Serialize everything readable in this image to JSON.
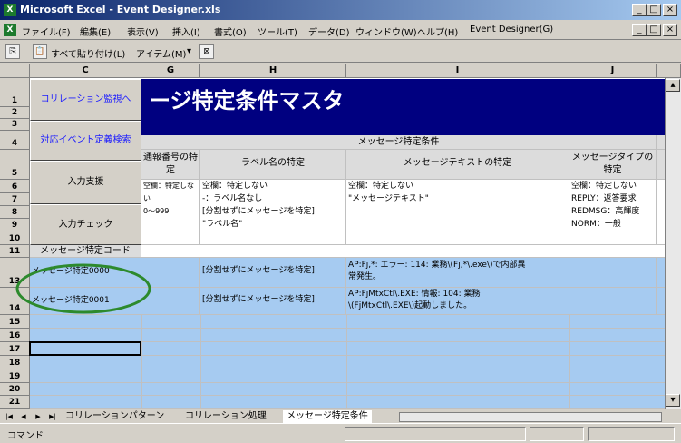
{
  "window": {
    "title": "Microsoft Excel - Event Designer.xls",
    "buttons": [
      "_",
      "□",
      "×"
    ]
  },
  "menu": [
    "ファイル(F)",
    "編集(E)",
    "表示(V)",
    "挿入(I)",
    "書式(O)",
    "ツール(T)",
    "データ(D)",
    "ウィンドウ(W)",
    "ヘルプ(H)",
    "Event Designer(G)"
  ],
  "doc_buttons": [
    "_",
    "□",
    "×"
  ],
  "toolbar": {
    "paste_all": "すべて貼り付け(L)",
    "items": "アイテム(M)"
  },
  "columns": [
    "C",
    "G",
    "H",
    "I",
    "J"
  ],
  "rows": [
    "1",
    "2",
    "3",
    "4",
    "5",
    "6",
    "7",
    "8",
    "9",
    "10",
    "11",
    "13",
    "14",
    "15",
    "16",
    "17",
    "18",
    "19",
    "20",
    "21"
  ],
  "nav_buttons": {
    "correlation_monitor": "コリレーション監視へ",
    "event_def_search": "対応イベント定義検索",
    "input_support": "入力支援",
    "input_check": "入力チェック"
  },
  "sheet": {
    "banner": "ージ特定条件マスタ",
    "section_title": "メッセージ特定条件",
    "code_header": "メッセージ特定コード",
    "headers": {
      "g": "通報番号の特定",
      "h": "ラベル名の特定",
      "i": "メッセージテキストの特定",
      "j": "メッセージタイプの特定"
    },
    "notes": {
      "g": [
        "空欄：特定しない",
        "0～999"
      ],
      "h": [
        "空欄：特定しない",
        "-：ラベル名なし",
        "[分割せずにメッセージを特定]",
        "\"ラベル名\""
      ],
      "i": [
        "空欄：特定しない",
        "\"メッセージテキスト\""
      ],
      "j": [
        "空欄：特定しない",
        "REPLY：返答要求",
        "REDMSG：高輝度",
        "NORM：一般"
      ]
    },
    "data_rows": [
      {
        "code": "メッセージ特定0000",
        "label": "[分割せずにメッセージを特定]",
        "text1": "AP:Fj,*: エラー: 114: 業務\\(Fj,*\\.exe\\)で内部異",
        "text2": "常発生。"
      },
      {
        "code": "メッセージ特定0001",
        "label": "[分割せずにメッセージを特定]",
        "text1": "AP:FjMtxCtl\\.EXE: 情報: 104: 業務",
        "text2": "\\(FjMtxCtl\\.EXE\\)起動しました。"
      }
    ]
  },
  "tabs": [
    "コリレーションパターン",
    "コリレーション処理",
    "メッセージ特定条件"
  ],
  "status": "コマンド",
  "colors": {
    "banner": "#000080",
    "selected_row": "#a6cbf1",
    "circle": "#2d8a2d"
  }
}
